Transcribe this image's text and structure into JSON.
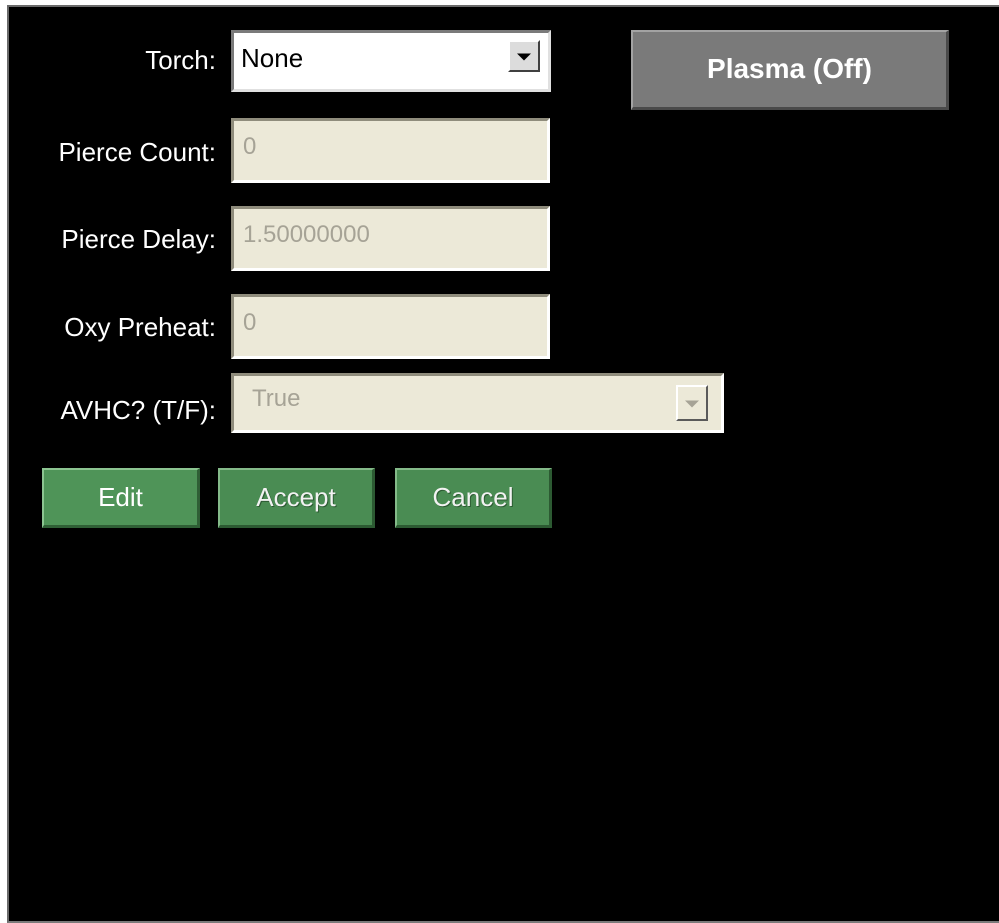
{
  "labels": {
    "torch": "Torch:",
    "pierce_count": "Pierce Count:",
    "pierce_delay": "Pierce Delay:",
    "oxy_preheat": "Oxy Preheat:",
    "avhc": "AVHC? (T/F):"
  },
  "fields": {
    "torch": {
      "value": "None",
      "icon": "chevron-down-icon"
    },
    "pierce_count": {
      "value": "0"
    },
    "pierce_delay": {
      "value": "1.50000000"
    },
    "oxy_preheat": {
      "value": "0"
    },
    "avhc": {
      "value": "True",
      "icon": "chevron-down-icon"
    }
  },
  "buttons": {
    "plasma": "Plasma (Off)",
    "edit": "Edit",
    "accept": "Accept",
    "cancel": "Cancel"
  },
  "colors": {
    "background": "#000000",
    "disabled_field": "#ece9d8",
    "disabled_text": "#a6a396",
    "plasma_button": "#7a7a7a",
    "green_button": "#4f9458"
  }
}
